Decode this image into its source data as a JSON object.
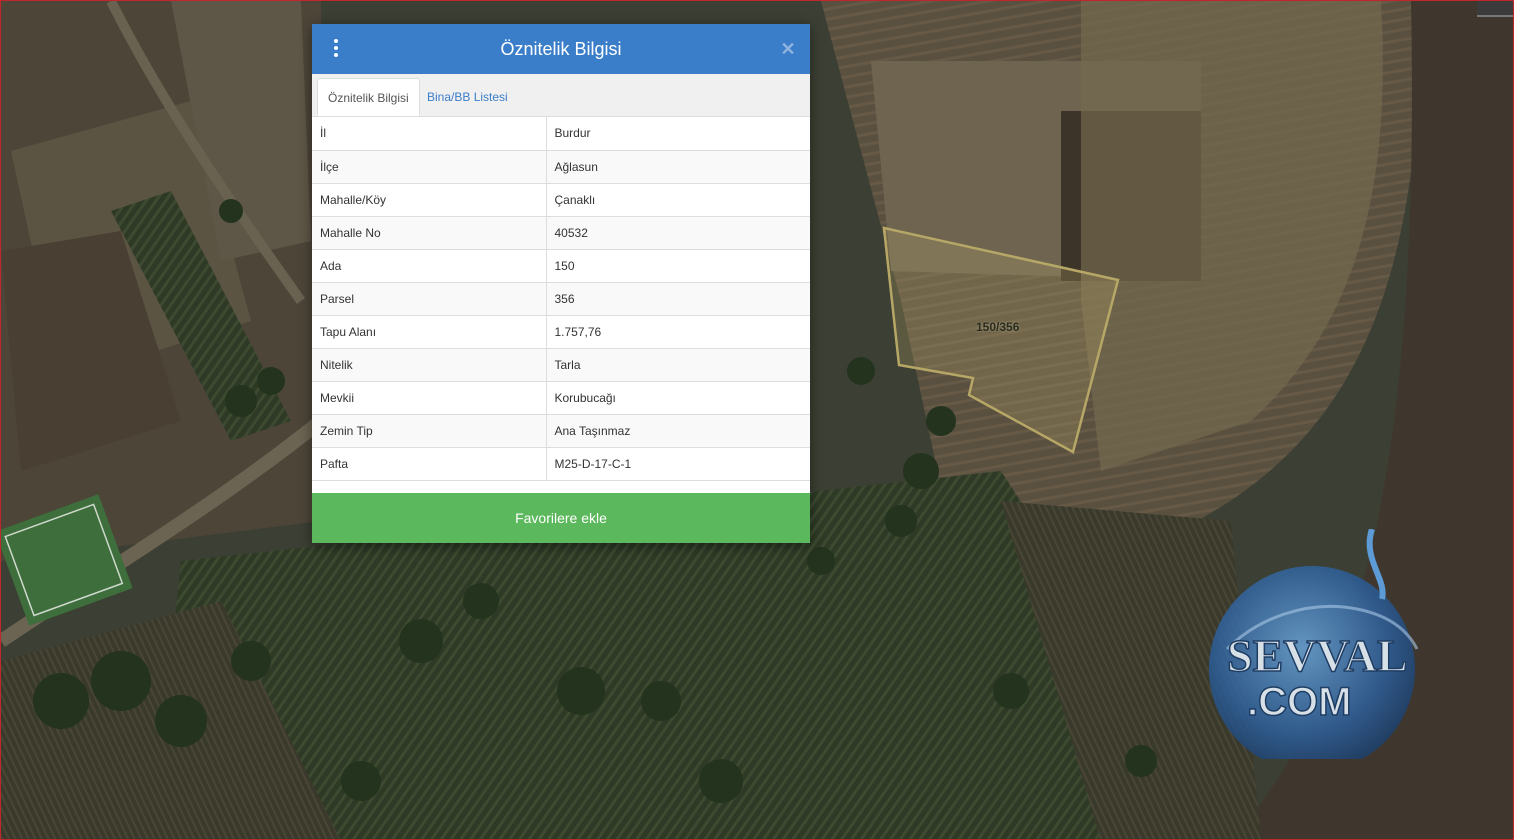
{
  "dialog": {
    "title": "Öznitelik Bilgisi",
    "menu_icon": "vertical-dots-icon",
    "close_icon": "close-x-icon",
    "close_glyph": "✕",
    "tabs": [
      {
        "label": "Öznitelik Bilgisi",
        "active": true
      },
      {
        "label": "Bina/BB Listesi",
        "active": false
      }
    ],
    "rows": [
      {
        "key": "İl",
        "value": "Burdur"
      },
      {
        "key": "İlçe",
        "value": "Ağlasun"
      },
      {
        "key": "Mahalle/Köy",
        "value": "Çanaklı"
      },
      {
        "key": "Mahalle No",
        "value": "40532"
      },
      {
        "key": "Ada",
        "value": "150"
      },
      {
        "key": "Parsel",
        "value": "356"
      },
      {
        "key": "Tapu Alanı",
        "value": "1.757,76"
      },
      {
        "key": "Nitelik",
        "value": "Tarla"
      },
      {
        "key": "Mevkii",
        "value": "Korubucağı"
      },
      {
        "key": "Zemin Tip",
        "value": "Ana Taşınmaz"
      },
      {
        "key": "Pafta",
        "value": "M25-D-17-C-1"
      }
    ],
    "favorite_button": "Favorilere ekle"
  },
  "map": {
    "parcel_label": "150/356",
    "parcel_outline_color": "#b7a767"
  },
  "watermark": {
    "line1": "SEVVAL",
    "line2": ".COM"
  },
  "colors": {
    "header": "#3a7dc9",
    "button": "#5cb85c",
    "tab_link": "#3a7dc9"
  }
}
